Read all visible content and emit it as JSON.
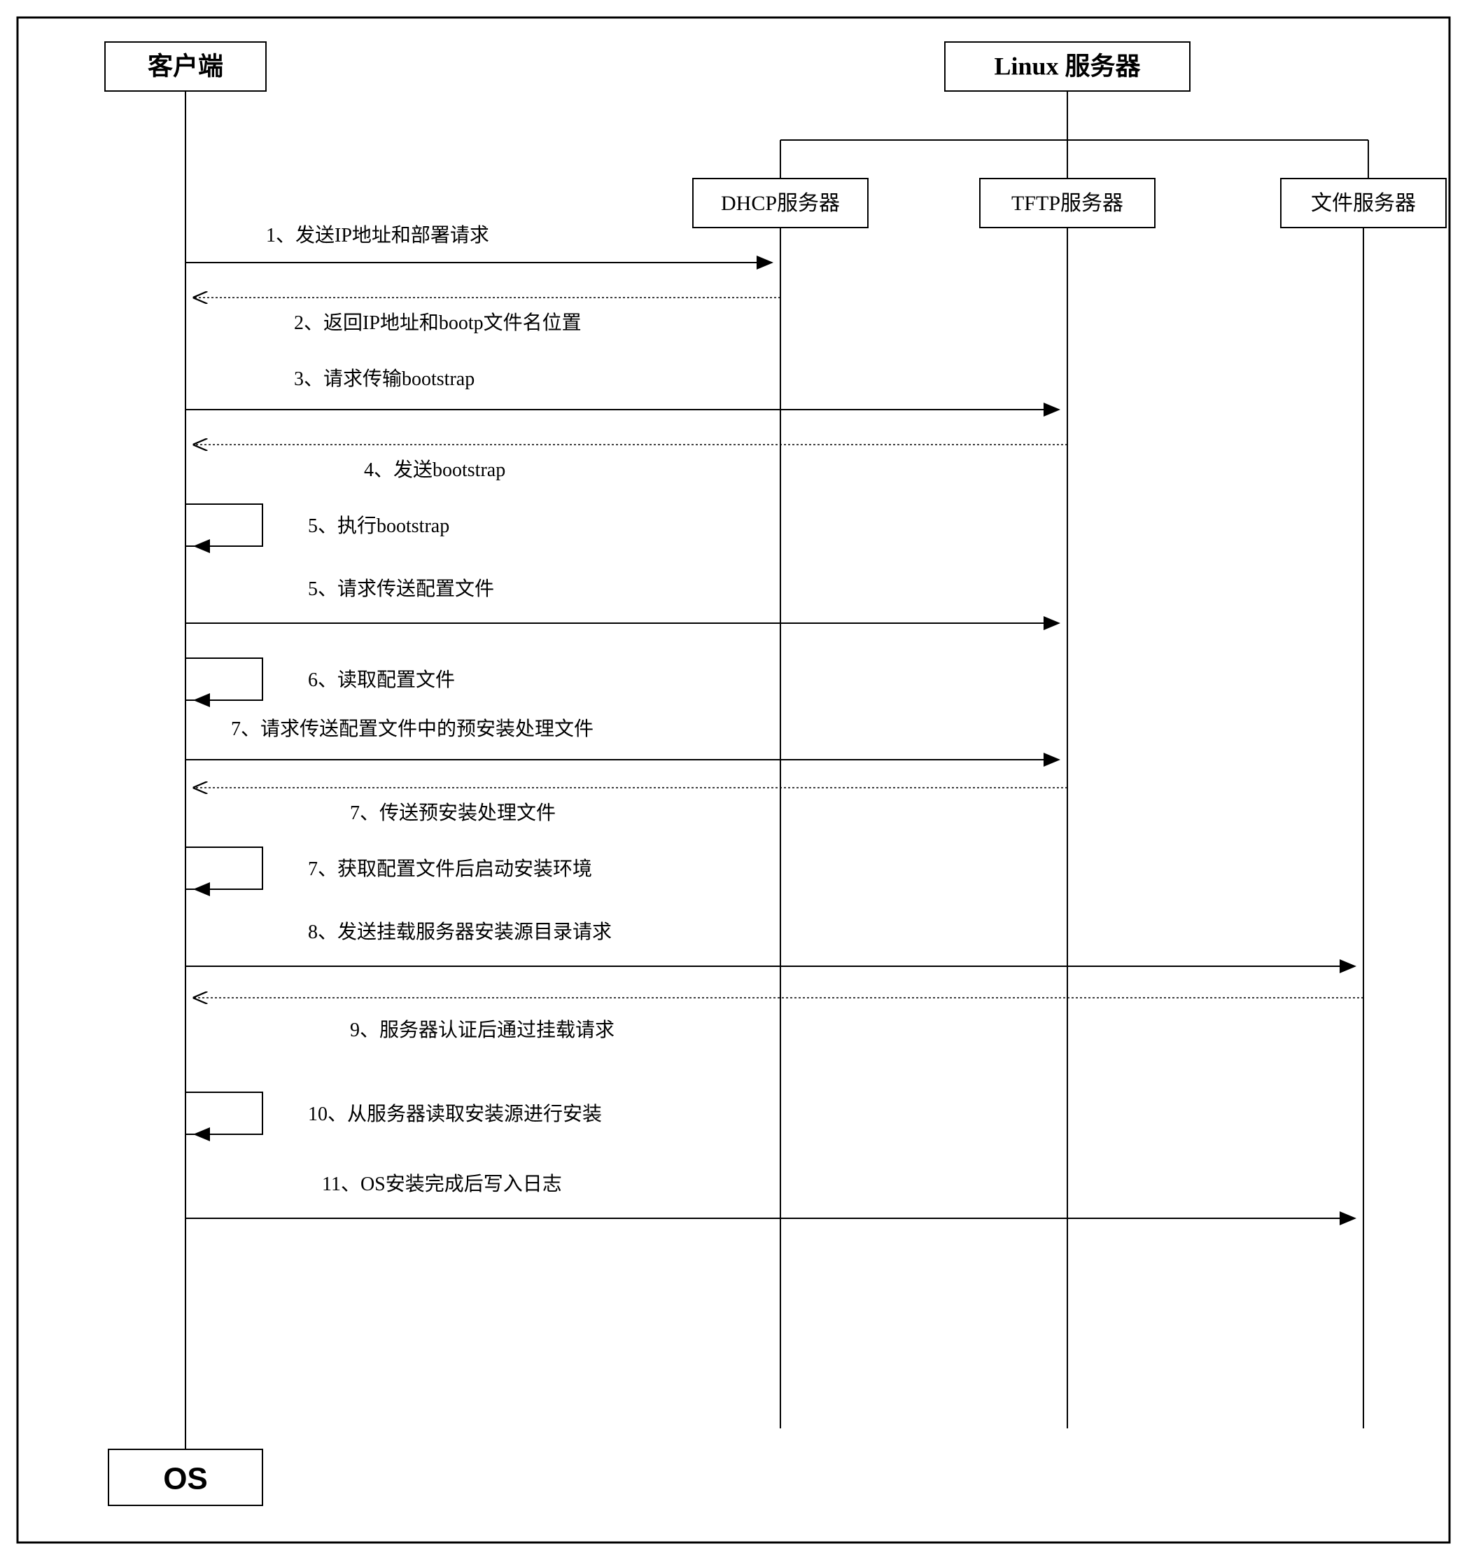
{
  "participants": {
    "client": "客户端",
    "linux_server": "Linux 服务器",
    "dhcp": "DHCP服务器",
    "tftp": "TFTP服务器",
    "file": "文件服务器",
    "os": "OS"
  },
  "messages": {
    "m1": "1、发送IP地址和部署请求",
    "m2": "2、返回IP地址和bootp文件名位置",
    "m3": "3、请求传输bootstrap",
    "m4": "4、发送bootstrap",
    "m5a": "5、执行bootstrap",
    "m5b": "5、请求传送配置文件",
    "m6": "6、读取配置文件",
    "m7a": "7、请求传送配置文件中的预安装处理文件",
    "m7b": "7、传送预安装处理文件",
    "m7c": "7、获取配置文件后启动安装环境",
    "m8": "8、发送挂载服务器安装源目录请求",
    "m9": "9、服务器认证后通过挂载请求",
    "m10": "10、从服务器读取安装源进行安装",
    "m11": "11、OS安装完成后写入日志"
  }
}
